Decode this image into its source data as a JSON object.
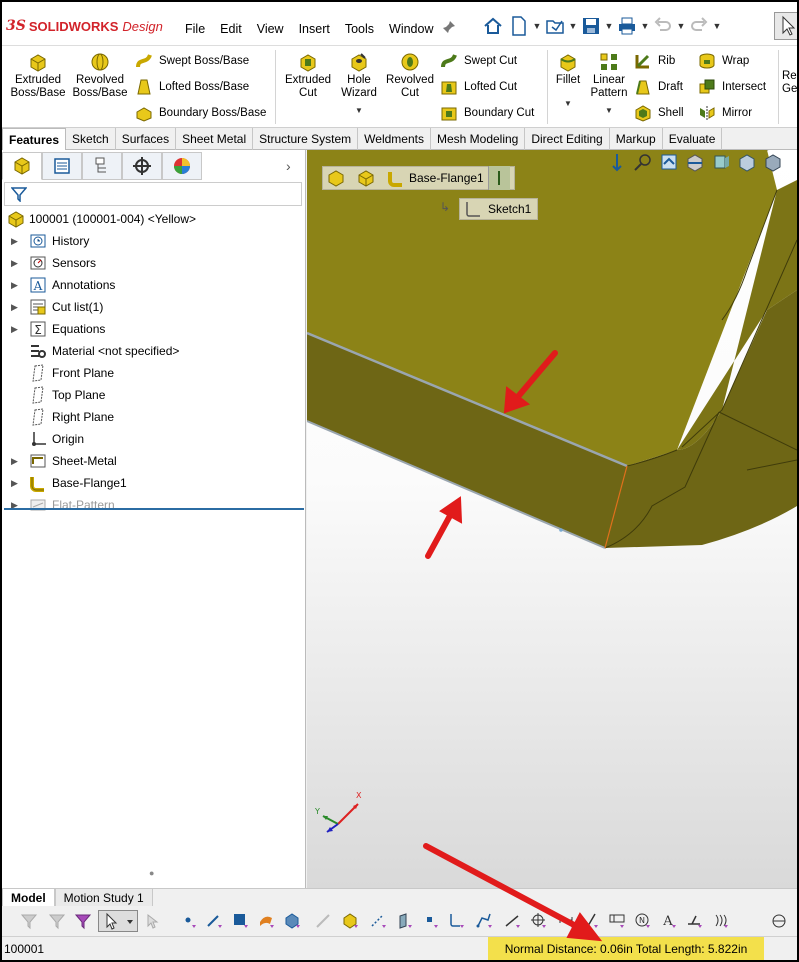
{
  "app": {
    "logo_ds": "3S",
    "logo_brand": "SOLIDWORKS",
    "logo_edition": "Design",
    "menus": [
      "File",
      "Edit",
      "View",
      "Insert",
      "Tools",
      "Window"
    ]
  },
  "ribbon": {
    "big_buttons": [
      {
        "label": "Extruded\nBoss/Base",
        "icon": "extruded-boss-icon"
      },
      {
        "label": "Revolved\nBoss/Base",
        "icon": "revolved-boss-icon"
      },
      {
        "label": "Extruded\nCut",
        "icon": "extruded-cut-icon"
      },
      {
        "label": "Hole\nWizard",
        "icon": "hole-wizard-icon"
      },
      {
        "label": "Revolved\nCut",
        "icon": "revolved-cut-icon"
      },
      {
        "label": "Fillet",
        "icon": "fillet-icon"
      },
      {
        "label": "Linear\nPattern",
        "icon": "linear-pattern-icon"
      }
    ],
    "small_buttons": [
      {
        "label": "Swept Boss/Base",
        "icon": "swept-boss-icon"
      },
      {
        "label": "Lofted Boss/Base",
        "icon": "lofted-boss-icon"
      },
      {
        "label": "Boundary Boss/Base",
        "icon": "boundary-boss-icon"
      },
      {
        "label": "Swept Cut",
        "icon": "swept-cut-icon"
      },
      {
        "label": "Lofted Cut",
        "icon": "lofted-cut-icon"
      },
      {
        "label": "Boundary Cut",
        "icon": "boundary-cut-icon"
      },
      {
        "label": "Rib",
        "icon": "rib-icon"
      },
      {
        "label": "Draft",
        "icon": "draft-icon"
      },
      {
        "label": "Shell",
        "icon": "shell-icon"
      },
      {
        "label": "Wrap",
        "icon": "wrap-icon"
      },
      {
        "label": "Intersect",
        "icon": "intersect-icon"
      },
      {
        "label": "Mirror",
        "icon": "mirror-icon"
      }
    ],
    "cut_off_label": "Re\nGe"
  },
  "tabs": [
    "Features",
    "Sketch",
    "Surfaces",
    "Sheet Metal",
    "Structure System",
    "Weldments",
    "Mesh Modeling",
    "Direct Editing",
    "Markup",
    "Evaluate"
  ],
  "tree": {
    "root": "100001 (100001-004) <Yellow>",
    "nodes": [
      {
        "label": "History",
        "expandable": true,
        "dim": false
      },
      {
        "label": "Sensors",
        "expandable": true,
        "dim": false
      },
      {
        "label": "Annotations",
        "expandable": true,
        "dim": false
      },
      {
        "label": "Cut list(1)",
        "expandable": true,
        "dim": false
      },
      {
        "label": "Equations",
        "expandable": true,
        "dim": false
      },
      {
        "label": "Material <not specified>",
        "expandable": false,
        "dim": false
      },
      {
        "label": "Front Plane",
        "expandable": false,
        "dim": false
      },
      {
        "label": "Top Plane",
        "expandable": false,
        "dim": false
      },
      {
        "label": "Right Plane",
        "expandable": false,
        "dim": false
      },
      {
        "label": "Origin",
        "expandable": false,
        "dim": false
      },
      {
        "label": "Sheet-Metal",
        "expandable": true,
        "dim": false
      },
      {
        "label": "Base-Flange1",
        "expandable": true,
        "dim": false
      },
      {
        "label": "Flat-Pattern",
        "expandable": true,
        "dim": true
      }
    ]
  },
  "viewport": {
    "breadcrumb_feature": "Base-Flange1",
    "breadcrumb_sketch": "Sketch1",
    "triad": {
      "x": "X",
      "y": "Y",
      "z": "Z"
    },
    "colors": {
      "part_top": "#8c8317",
      "part_side": "#6e6615",
      "background_top": "#ffffff",
      "background_bottom": "#dcdcdc",
      "edge_highlight": "#e0701c",
      "annotation_arrow": "#e11b1b"
    }
  },
  "bottom_tabs": [
    "Model",
    "Motion Study 1"
  ],
  "status": {
    "left": "100001",
    "measure": "Normal Distance: 0.06in Total Length: 5.822in",
    "measure_bg": "#f3e04b"
  }
}
